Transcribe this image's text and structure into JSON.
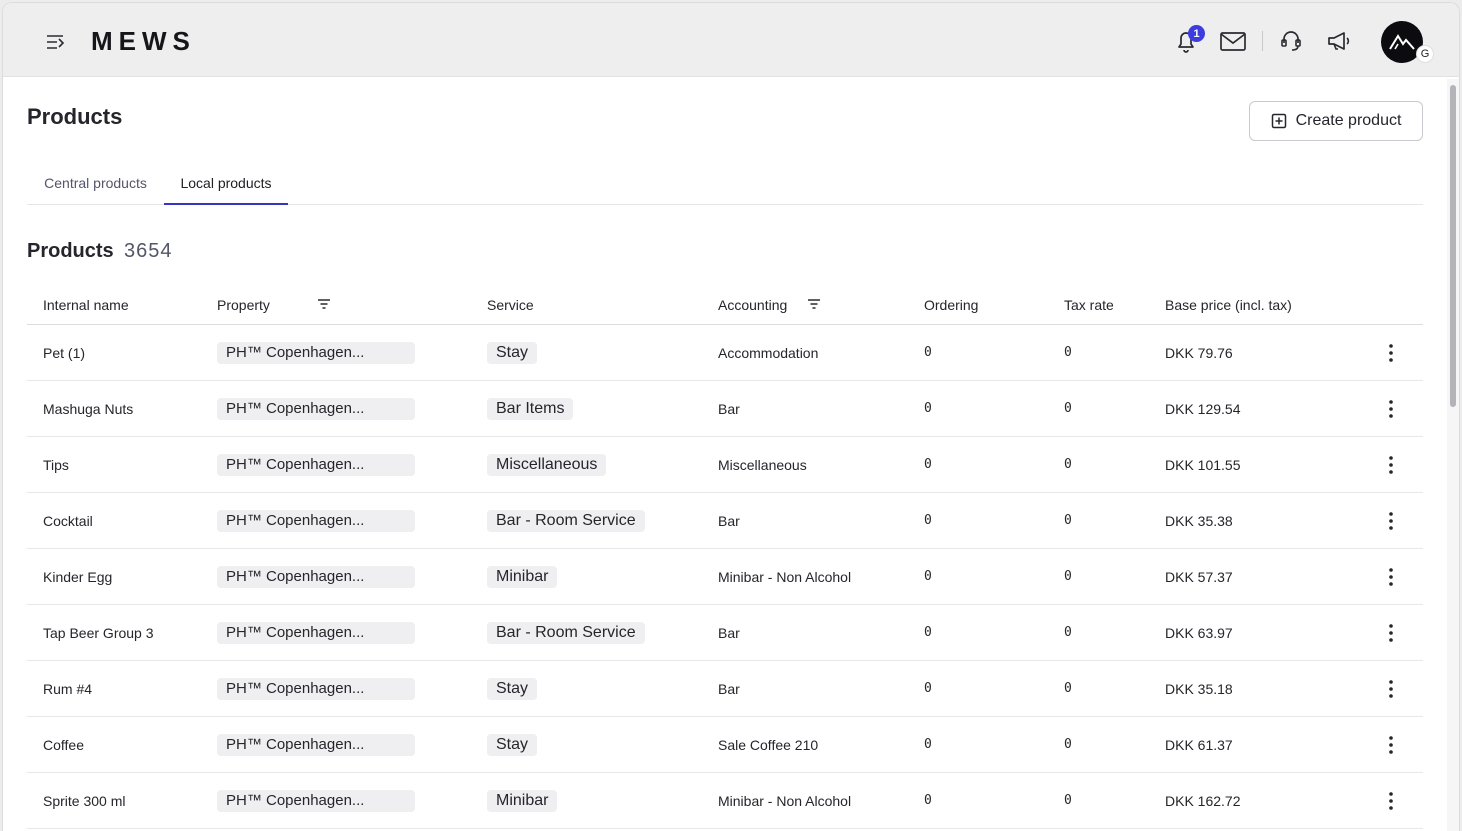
{
  "header": {
    "logo_text": "MEWS",
    "notification_count": "1",
    "avatar_initial": "G",
    "icons": [
      "menu-icon",
      "bell-icon",
      "mail-icon",
      "support-icon",
      "announcement-icon"
    ]
  },
  "page": {
    "title": "Products",
    "create_button_label": "Create product"
  },
  "tabs": [
    {
      "label": "Central products",
      "active": false
    },
    {
      "label": "Local products",
      "active": true
    }
  ],
  "products_section": {
    "title": "Products",
    "count": "3654"
  },
  "table": {
    "columns": [
      "Internal name",
      "Property",
      "Service",
      "Accounting",
      "Ordering",
      "Tax rate",
      "Base price (incl. tax)"
    ],
    "rows": [
      {
        "name": "Pet (1)",
        "property": "PH™ Copenhagen...",
        "service": "Stay",
        "accounting": "Accommodation",
        "ordering": "0",
        "tax_rate": "0",
        "price": "DKK 79.76"
      },
      {
        "name": "Mashuga Nuts",
        "property": "PH™ Copenhagen...",
        "service": "Bar Items",
        "accounting": "Bar",
        "ordering": "0",
        "tax_rate": "0",
        "price": "DKK 129.54"
      },
      {
        "name": "Tips",
        "property": "PH™ Copenhagen...",
        "service": "Miscellaneous",
        "accounting": "Miscellaneous",
        "ordering": "0",
        "tax_rate": "0",
        "price": "DKK 101.55"
      },
      {
        "name": "Cocktail",
        "property": "PH™ Copenhagen...",
        "service": "Bar - Room Service",
        "accounting": "Bar",
        "ordering": "0",
        "tax_rate": "0",
        "price": "DKK 35.38"
      },
      {
        "name": "Kinder Egg",
        "property": "PH™ Copenhagen...",
        "service": "Minibar",
        "accounting": "Minibar - Non Alcohol",
        "ordering": "0",
        "tax_rate": "0",
        "price": "DKK 57.37"
      },
      {
        "name": "Tap Beer Group 3",
        "property": "PH™ Copenhagen...",
        "service": "Bar - Room Service",
        "accounting": "Bar",
        "ordering": "0",
        "tax_rate": "0",
        "price": "DKK 63.97"
      },
      {
        "name": "Rum #4",
        "property": "PH™ Copenhagen...",
        "service": "Stay",
        "accounting": "Bar",
        "ordering": "0",
        "tax_rate": "0",
        "price": "DKK 35.18"
      },
      {
        "name": "Coffee",
        "property": "PH™ Copenhagen...",
        "service": "Stay",
        "accounting": "Sale Coffee 210",
        "ordering": "0",
        "tax_rate": "0",
        "price": "DKK 61.37"
      },
      {
        "name": "Sprite 300 ml",
        "property": "PH™ Copenhagen...",
        "service": "Minibar",
        "accounting": "Minibar - Non Alcohol",
        "ordering": "0",
        "tax_rate": "0",
        "price": "DKK 162.72"
      }
    ]
  },
  "colors": {
    "accent": "#3434c8",
    "badge": "#3d3dde",
    "pill_bg": "#efeff2"
  }
}
